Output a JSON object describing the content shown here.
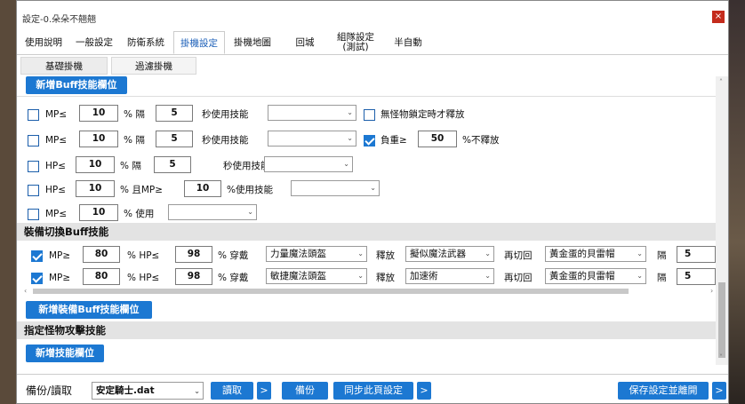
{
  "window": {
    "title": "設定-0.朵朵不翹翹",
    "close": "×"
  },
  "tabs": [
    "使用說明",
    "一般設定",
    "防衛系統",
    "掛機設定",
    "掛機地圖",
    "回城",
    "組隊設定\n(測試)",
    "半自動"
  ],
  "subtabs": [
    "基礎掛機",
    "過濾掛機"
  ],
  "buff": {
    "add_button": "新增Buff技能欄位",
    "rows": [
      {
        "checked": false,
        "stat": "MP≤",
        "value": "10",
        "unit": "% 隔",
        "interval": "5",
        "suffix": "秒使用技能",
        "skill": "",
        "extra_checked": false,
        "extra_label": "無怪物鎖定時才釋放"
      },
      {
        "checked": false,
        "stat": "MP≤",
        "value": "10",
        "unit": "% 隔",
        "interval": "5",
        "suffix": "秒使用技能",
        "skill": "",
        "extra_checked": true,
        "extra_label": "負重≥",
        "extra_value": "50",
        "extra_suffix": "%不釋放"
      },
      {
        "checked": false,
        "stat": "HP≤",
        "value": "10",
        "unit": "% 隔",
        "interval": "5",
        "suffix": "秒使用技能",
        "skill": ""
      },
      {
        "checked": false,
        "stat": "HP≤",
        "value": "10",
        "unit": "% 且MP≥",
        "interval": "10",
        "suffix": "%使用技能",
        "skill": ""
      },
      {
        "checked": false,
        "stat": "MP≤",
        "value": "10",
        "unit": "% 使用",
        "skill": ""
      }
    ]
  },
  "equip": {
    "title": "裝備切換Buff技能",
    "add_button": "新增裝備Buff技能欄位",
    "rows": [
      {
        "checked": true,
        "mp_label": "MP≥",
        "mp": "80",
        "hp_label": "% HP≤",
        "hp": "98",
        "wear": "% 穿戴",
        "wear_item": "力量魔法頭盔",
        "release": "釋放",
        "skill": "擬似魔法武器",
        "switch": "再切回",
        "back_item": "黃金蛋的貝雷帽",
        "gap": "隔",
        "gap_value": "5"
      },
      {
        "checked": true,
        "mp_label": "MP≥",
        "mp": "80",
        "hp_label": "% HP≤",
        "hp": "98",
        "wear": "% 穿戴",
        "wear_item": "敏捷魔法頭盔",
        "release": "釋放",
        "skill": "加速術",
        "switch": "再切回",
        "back_item": "黃金蛋的貝雷帽",
        "gap": "隔",
        "gap_value": "5"
      }
    ]
  },
  "monster": {
    "title": "指定怪物攻擊技能",
    "add_button": "新增技能欄位"
  },
  "footer": {
    "backup_label": "備份/讀取",
    "file": "安定騎士.dat",
    "read": "讀取",
    "more": ">",
    "backup": "備份",
    "sync": "同步此頁設定",
    "save": "保存設定並離開"
  },
  "colors": {
    "accent": "#1c78d2",
    "section_bg": "#e3e3e3",
    "close": "#c42b1c"
  }
}
